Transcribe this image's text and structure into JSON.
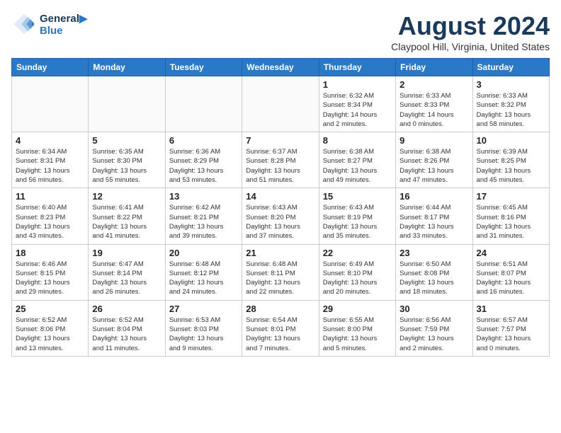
{
  "header": {
    "logo_line1": "General",
    "logo_line2": "Blue",
    "month_title": "August 2024",
    "location": "Claypool Hill, Virginia, United States"
  },
  "weekdays": [
    "Sunday",
    "Monday",
    "Tuesday",
    "Wednesday",
    "Thursday",
    "Friday",
    "Saturday"
  ],
  "weeks": [
    [
      {
        "day": "",
        "info": ""
      },
      {
        "day": "",
        "info": ""
      },
      {
        "day": "",
        "info": ""
      },
      {
        "day": "",
        "info": ""
      },
      {
        "day": "1",
        "info": "Sunrise: 6:32 AM\nSunset: 8:34 PM\nDaylight: 14 hours\nand 2 minutes."
      },
      {
        "day": "2",
        "info": "Sunrise: 6:33 AM\nSunset: 8:33 PM\nDaylight: 14 hours\nand 0 minutes."
      },
      {
        "day": "3",
        "info": "Sunrise: 6:33 AM\nSunset: 8:32 PM\nDaylight: 13 hours\nand 58 minutes."
      }
    ],
    [
      {
        "day": "4",
        "info": "Sunrise: 6:34 AM\nSunset: 8:31 PM\nDaylight: 13 hours\nand 56 minutes."
      },
      {
        "day": "5",
        "info": "Sunrise: 6:35 AM\nSunset: 8:30 PM\nDaylight: 13 hours\nand 55 minutes."
      },
      {
        "day": "6",
        "info": "Sunrise: 6:36 AM\nSunset: 8:29 PM\nDaylight: 13 hours\nand 53 minutes."
      },
      {
        "day": "7",
        "info": "Sunrise: 6:37 AM\nSunset: 8:28 PM\nDaylight: 13 hours\nand 51 minutes."
      },
      {
        "day": "8",
        "info": "Sunrise: 6:38 AM\nSunset: 8:27 PM\nDaylight: 13 hours\nand 49 minutes."
      },
      {
        "day": "9",
        "info": "Sunrise: 6:38 AM\nSunset: 8:26 PM\nDaylight: 13 hours\nand 47 minutes."
      },
      {
        "day": "10",
        "info": "Sunrise: 6:39 AM\nSunset: 8:25 PM\nDaylight: 13 hours\nand 45 minutes."
      }
    ],
    [
      {
        "day": "11",
        "info": "Sunrise: 6:40 AM\nSunset: 8:23 PM\nDaylight: 13 hours\nand 43 minutes."
      },
      {
        "day": "12",
        "info": "Sunrise: 6:41 AM\nSunset: 8:22 PM\nDaylight: 13 hours\nand 41 minutes."
      },
      {
        "day": "13",
        "info": "Sunrise: 6:42 AM\nSunset: 8:21 PM\nDaylight: 13 hours\nand 39 minutes."
      },
      {
        "day": "14",
        "info": "Sunrise: 6:43 AM\nSunset: 8:20 PM\nDaylight: 13 hours\nand 37 minutes."
      },
      {
        "day": "15",
        "info": "Sunrise: 6:43 AM\nSunset: 8:19 PM\nDaylight: 13 hours\nand 35 minutes."
      },
      {
        "day": "16",
        "info": "Sunrise: 6:44 AM\nSunset: 8:17 PM\nDaylight: 13 hours\nand 33 minutes."
      },
      {
        "day": "17",
        "info": "Sunrise: 6:45 AM\nSunset: 8:16 PM\nDaylight: 13 hours\nand 31 minutes."
      }
    ],
    [
      {
        "day": "18",
        "info": "Sunrise: 6:46 AM\nSunset: 8:15 PM\nDaylight: 13 hours\nand 29 minutes."
      },
      {
        "day": "19",
        "info": "Sunrise: 6:47 AM\nSunset: 8:14 PM\nDaylight: 13 hours\nand 26 minutes."
      },
      {
        "day": "20",
        "info": "Sunrise: 6:48 AM\nSunset: 8:12 PM\nDaylight: 13 hours\nand 24 minutes."
      },
      {
        "day": "21",
        "info": "Sunrise: 6:48 AM\nSunset: 8:11 PM\nDaylight: 13 hours\nand 22 minutes."
      },
      {
        "day": "22",
        "info": "Sunrise: 6:49 AM\nSunset: 8:10 PM\nDaylight: 13 hours\nand 20 minutes."
      },
      {
        "day": "23",
        "info": "Sunrise: 6:50 AM\nSunset: 8:08 PM\nDaylight: 13 hours\nand 18 minutes."
      },
      {
        "day": "24",
        "info": "Sunrise: 6:51 AM\nSunset: 8:07 PM\nDaylight: 13 hours\nand 16 minutes."
      }
    ],
    [
      {
        "day": "25",
        "info": "Sunrise: 6:52 AM\nSunset: 8:06 PM\nDaylight: 13 hours\nand 13 minutes."
      },
      {
        "day": "26",
        "info": "Sunrise: 6:52 AM\nSunset: 8:04 PM\nDaylight: 13 hours\nand 11 minutes."
      },
      {
        "day": "27",
        "info": "Sunrise: 6:53 AM\nSunset: 8:03 PM\nDaylight: 13 hours\nand 9 minutes."
      },
      {
        "day": "28",
        "info": "Sunrise: 6:54 AM\nSunset: 8:01 PM\nDaylight: 13 hours\nand 7 minutes."
      },
      {
        "day": "29",
        "info": "Sunrise: 6:55 AM\nSunset: 8:00 PM\nDaylight: 13 hours\nand 5 minutes."
      },
      {
        "day": "30",
        "info": "Sunrise: 6:56 AM\nSunset: 7:59 PM\nDaylight: 13 hours\nand 2 minutes."
      },
      {
        "day": "31",
        "info": "Sunrise: 6:57 AM\nSunset: 7:57 PM\nDaylight: 13 hours\nand 0 minutes."
      }
    ]
  ]
}
